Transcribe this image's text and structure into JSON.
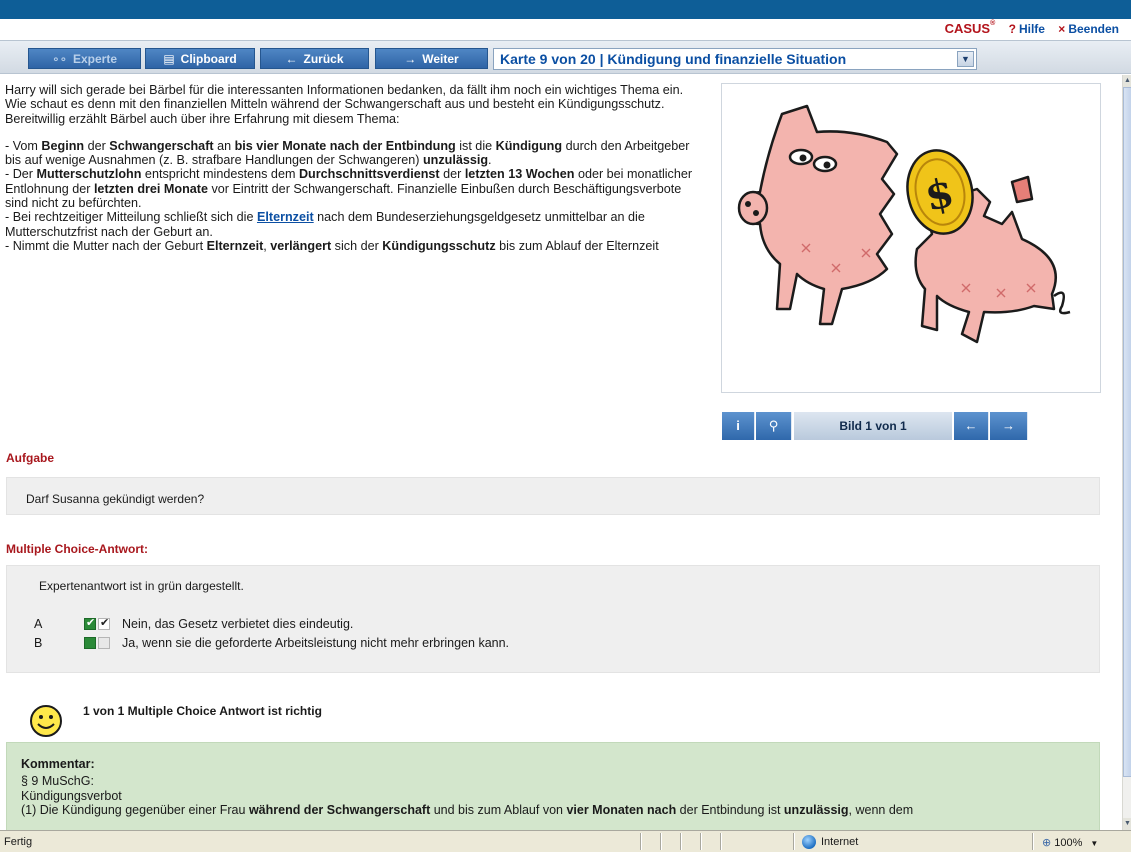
{
  "brandbar": {
    "brand": "CASUS",
    "brand_mark": "®",
    "help_symbol": "?",
    "help_label": "Hilfe",
    "exit_symbol": "×",
    "exit_label": "Beenden"
  },
  "navbar": {
    "experte_icon": "∘∘",
    "experte_label": "Experte",
    "clipboard_icon": "▤",
    "clipboard_label": "Clipboard",
    "back_icon": "←",
    "back_label": "Zurück",
    "forward_icon": "→",
    "forward_label": "Weiter",
    "card_selected": "Karte 9 von 20 | Kündigung und finanzielle Situation"
  },
  "image_panel": {
    "info_icon": "i",
    "zoom_icon": "⚲",
    "counter": "Bild 1 von 1",
    "prev_icon": "←",
    "next_icon": "→"
  },
  "task": {
    "title": "Aufgabe",
    "question": "Darf Susanna gekündigt werden?"
  },
  "mc": {
    "title": "Multiple Choice-Antwort:",
    "hint": "Expertenantwort ist in grün dargestellt.",
    "options": [
      {
        "letter": "A",
        "text": "Nein, das Gesetz verbietet dies eindeutig.",
        "expert": true,
        "chosen": true
      },
      {
        "letter": "B",
        "text": "Ja, wenn sie die geforderte Arbeitsleistung nicht mehr erbringen kann.",
        "expert": false,
        "chosen": false
      }
    ]
  },
  "result": {
    "text": "1 von 1 Multiple Choice Antwort ist richtig"
  },
  "kommentar": {
    "title": "Kommentar:",
    "line1": "§ 9 MuSchG:",
    "line2": "Kündigungsverbot"
  },
  "statusbar": {
    "status": "Fertig",
    "zone": "Internet",
    "zoom": "100%",
    "zoom_icon": "⊕",
    "dropdown_icon": "▼"
  },
  "colors": {
    "accent_blue": "#2f64a6",
    "header_blue": "#0e5e97",
    "title_red": "#a8171d",
    "expert_green": "#2b8a38",
    "comment_bg": "#d3e6cc"
  }
}
